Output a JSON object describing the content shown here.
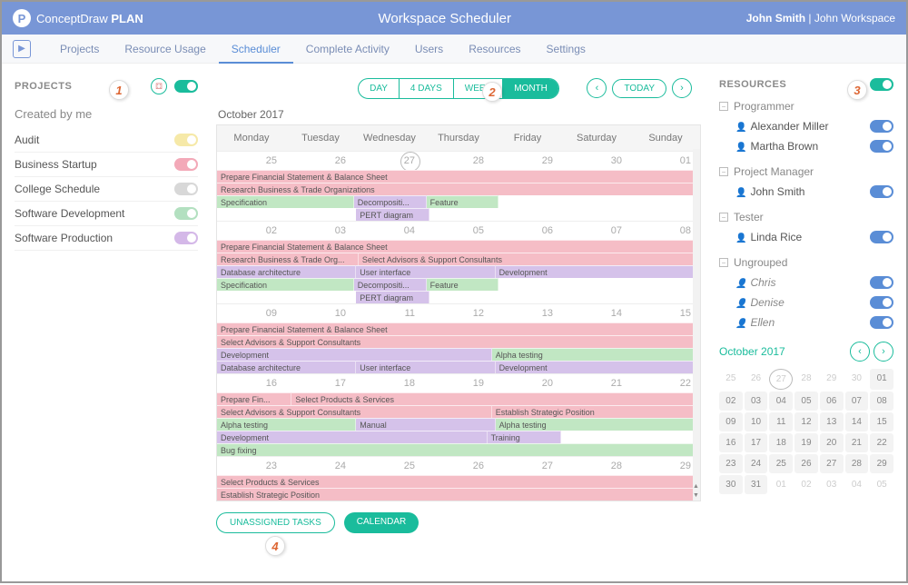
{
  "header": {
    "brand": "ConceptDraw",
    "brand2": "PLAN",
    "title": "Workspace Scheduler",
    "user_name": "John Smith",
    "workspace": "John Workspace"
  },
  "nav": {
    "items": [
      "Projects",
      "Resource Usage",
      "Scheduler",
      "Complete Activity",
      "Users",
      "Resources",
      "Settings"
    ],
    "active": "Scheduler"
  },
  "projects": {
    "heading": "PROJECTS",
    "subheading": "Created by me",
    "items": [
      {
        "name": "Audit",
        "color": "yellow"
      },
      {
        "name": "Business Startup",
        "color": "pink"
      },
      {
        "name": "College Schedule",
        "color": "grey"
      },
      {
        "name": "Software Development",
        "color": "green"
      },
      {
        "name": "Software Production",
        "color": "purple"
      }
    ]
  },
  "views": {
    "options": [
      "DAY",
      "4 DAYS",
      "WEEK",
      "MONTH"
    ],
    "active": "MONTH",
    "today": "TODAY",
    "month_label": "October 2017"
  },
  "calendar": {
    "days": [
      "Monday",
      "Tuesday",
      "Wednesday",
      "Thursday",
      "Friday",
      "Saturday",
      "Sunday"
    ],
    "weeks": [
      {
        "dates": [
          "25",
          "26",
          "27",
          "28",
          "29",
          "30",
          "01"
        ],
        "today_index": 2,
        "rows": [
          [
            {
              "w": 7,
              "c": "p",
              "t": "Prepare Financial Statement & Balance Sheet"
            }
          ],
          [
            {
              "w": 7,
              "c": "p",
              "t": "Research Business & Trade Organizations"
            }
          ],
          [
            {
              "w": 2,
              "c": "g",
              "t": "Specification"
            },
            {
              "w": 1,
              "c": "v",
              "t": "Decompositi..."
            },
            {
              "w": 1,
              "c": "g",
              "t": "Feature"
            },
            {
              "w": 3,
              "c": "e",
              "t": ""
            }
          ],
          [
            {
              "w": 2,
              "c": "e",
              "t": ""
            },
            {
              "w": 1,
              "c": "v",
              "t": "PERT diagram"
            },
            {
              "w": 4,
              "c": "e",
              "t": ""
            }
          ]
        ]
      },
      {
        "dates": [
          "02",
          "03",
          "04",
          "05",
          "06",
          "07",
          "08"
        ],
        "rows": [
          [
            {
              "w": 7,
              "c": "p",
              "t": "Prepare Financial Statement & Balance Sheet"
            }
          ],
          [
            {
              "w": 2,
              "c": "p",
              "t": "Research Business & Trade Org..."
            },
            {
              "w": 5,
              "c": "p",
              "t": "Select Advisors & Support Consultants"
            }
          ],
          [
            {
              "w": 2,
              "c": "v",
              "t": "Database architecture"
            },
            {
              "w": 2,
              "c": "v",
              "t": "User interface"
            },
            {
              "w": 3,
              "c": "v",
              "t": "Development"
            }
          ],
          [
            {
              "w": 2,
              "c": "g",
              "t": "Specification"
            },
            {
              "w": 1,
              "c": "v",
              "t": "Decompositi..."
            },
            {
              "w": 1,
              "c": "g",
              "t": "Feature"
            },
            {
              "w": 3,
              "c": "e",
              "t": ""
            }
          ],
          [
            {
              "w": 2,
              "c": "e",
              "t": ""
            },
            {
              "w": 1,
              "c": "v",
              "t": "PERT diagram"
            },
            {
              "w": 4,
              "c": "e",
              "t": ""
            }
          ]
        ]
      },
      {
        "dates": [
          "09",
          "10",
          "11",
          "12",
          "13",
          "14",
          "15"
        ],
        "rows": [
          [
            {
              "w": 7,
              "c": "p",
              "t": "Prepare Financial Statement & Balance Sheet"
            }
          ],
          [
            {
              "w": 7,
              "c": "p",
              "t": "Select Advisors & Support Consultants"
            }
          ],
          [
            {
              "w": 4,
              "c": "v",
              "t": "Development"
            },
            {
              "w": 3,
              "c": "g",
              "t": "Alpha testing"
            }
          ],
          [
            {
              "w": 2,
              "c": "v",
              "t": "Database architecture"
            },
            {
              "w": 2,
              "c": "v",
              "t": "User interface"
            },
            {
              "w": 3,
              "c": "v",
              "t": "Development"
            }
          ]
        ]
      },
      {
        "dates": [
          "16",
          "17",
          "18",
          "19",
          "20",
          "21",
          "22"
        ],
        "rows": [
          [
            {
              "w": 1,
              "c": "p",
              "t": "Prepare Fin..."
            },
            {
              "w": 6,
              "c": "p",
              "t": "Select Products & Services"
            }
          ],
          [
            {
              "w": 4,
              "c": "p",
              "t": "Select Advisors & Support Consultants"
            },
            {
              "w": 3,
              "c": "p",
              "t": "Establish Strategic Position"
            }
          ],
          [
            {
              "w": 2,
              "c": "g",
              "t": "Alpha testing"
            },
            {
              "w": 2,
              "c": "v",
              "t": "Manual"
            },
            {
              "w": 3,
              "c": "g",
              "t": "Alpha testing"
            }
          ],
          [
            {
              "w": 4,
              "c": "v",
              "t": "Development"
            },
            {
              "w": 1,
              "c": "v",
              "t": "Training"
            },
            {
              "w": 2,
              "c": "e",
              "t": ""
            }
          ],
          [
            {
              "w": 7,
              "c": "g",
              "t": "Bug fixing"
            }
          ]
        ]
      },
      {
        "dates": [
          "23",
          "24",
          "25",
          "26",
          "27",
          "28",
          "29"
        ],
        "rows": [
          [
            {
              "w": 7,
              "c": "p",
              "t": "Select Products & Services"
            }
          ],
          [
            {
              "w": 7,
              "c": "p",
              "t": "Establish Strategic Position"
            }
          ]
        ]
      }
    ]
  },
  "bottom": {
    "unassigned": "UNASSIGNED TASKS",
    "calendar": "CALENDAR"
  },
  "resources": {
    "heading": "RESOURCES",
    "groups": [
      {
        "name": "Programmer",
        "members": [
          {
            "name": "Alexander Miller",
            "italic": false
          },
          {
            "name": "Martha Brown",
            "italic": false
          }
        ]
      },
      {
        "name": "Project Manager",
        "members": [
          {
            "name": "John Smith",
            "italic": false
          }
        ]
      },
      {
        "name": "Tester",
        "members": [
          {
            "name": "Linda Rice",
            "italic": false
          }
        ]
      },
      {
        "name": "Ungrouped",
        "members": [
          {
            "name": "Chris",
            "italic": true
          },
          {
            "name": "Denise",
            "italic": true
          },
          {
            "name": "Ellen",
            "italic": true
          }
        ]
      }
    ]
  },
  "mini": {
    "label": "October 2017",
    "cells": [
      {
        "d": "25",
        "dim": true
      },
      {
        "d": "26",
        "dim": true
      },
      {
        "d": "27",
        "dim": true,
        "cur": true
      },
      {
        "d": "28",
        "dim": true
      },
      {
        "d": "29",
        "dim": true
      },
      {
        "d": "30",
        "dim": true
      },
      {
        "d": "01",
        "hl": true
      },
      {
        "d": "02",
        "hl": true
      },
      {
        "d": "03",
        "hl": true
      },
      {
        "d": "04",
        "hl": true
      },
      {
        "d": "05",
        "hl": true
      },
      {
        "d": "06",
        "hl": true
      },
      {
        "d": "07",
        "hl": true
      },
      {
        "d": "08",
        "hl": true
      },
      {
        "d": "09",
        "hl": true
      },
      {
        "d": "10",
        "hl": true
      },
      {
        "d": "11",
        "hl": true
      },
      {
        "d": "12",
        "hl": true
      },
      {
        "d": "13",
        "hl": true
      },
      {
        "d": "14",
        "hl": true
      },
      {
        "d": "15",
        "hl": true
      },
      {
        "d": "16",
        "hl": true
      },
      {
        "d": "17",
        "hl": true
      },
      {
        "d": "18",
        "hl": true
      },
      {
        "d": "19",
        "hl": true
      },
      {
        "d": "20",
        "hl": true
      },
      {
        "d": "21",
        "hl": true
      },
      {
        "d": "22",
        "hl": true
      },
      {
        "d": "23",
        "hl": true
      },
      {
        "d": "24",
        "hl": true
      },
      {
        "d": "25",
        "hl": true
      },
      {
        "d": "26",
        "hl": true
      },
      {
        "d": "27",
        "hl": true
      },
      {
        "d": "28",
        "hl": true
      },
      {
        "d": "29",
        "hl": true
      },
      {
        "d": "30",
        "hl": true
      },
      {
        "d": "31",
        "hl": true
      },
      {
        "d": "01",
        "dim": true
      },
      {
        "d": "02",
        "dim": true
      },
      {
        "d": "03",
        "dim": true
      },
      {
        "d": "04",
        "dim": true
      },
      {
        "d": "05",
        "dim": true
      }
    ]
  },
  "callouts": {
    "c1": "1",
    "c2": "2",
    "c3": "3",
    "c4": "4"
  }
}
